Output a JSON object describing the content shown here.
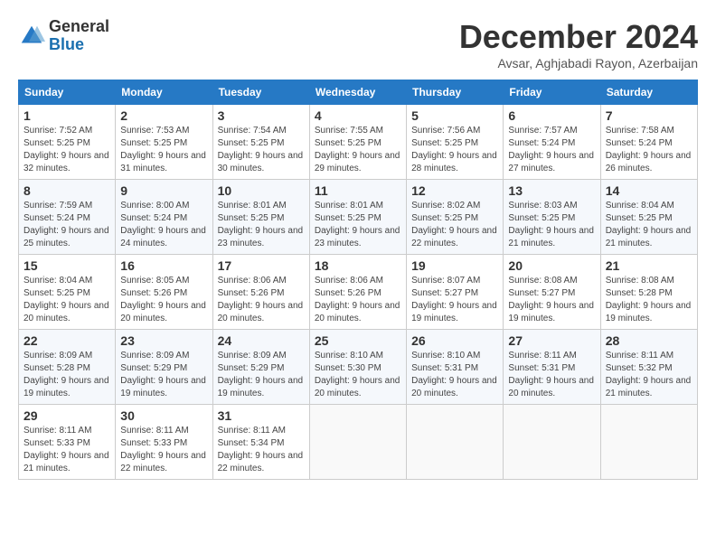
{
  "header": {
    "logo": {
      "general": "General",
      "blue": "Blue"
    },
    "title": "December 2024",
    "location": "Avsar, Aghjabadi Rayon, Azerbaijan"
  },
  "calendar": {
    "days_of_week": [
      "Sunday",
      "Monday",
      "Tuesday",
      "Wednesday",
      "Thursday",
      "Friday",
      "Saturday"
    ],
    "weeks": [
      [
        {
          "day": "1",
          "sunrise": "7:52 AM",
          "sunset": "5:25 PM",
          "daylight": "9 hours and 32 minutes."
        },
        {
          "day": "2",
          "sunrise": "7:53 AM",
          "sunset": "5:25 PM",
          "daylight": "9 hours and 31 minutes."
        },
        {
          "day": "3",
          "sunrise": "7:54 AM",
          "sunset": "5:25 PM",
          "daylight": "9 hours and 30 minutes."
        },
        {
          "day": "4",
          "sunrise": "7:55 AM",
          "sunset": "5:25 PM",
          "daylight": "9 hours and 29 minutes."
        },
        {
          "day": "5",
          "sunrise": "7:56 AM",
          "sunset": "5:25 PM",
          "daylight": "9 hours and 28 minutes."
        },
        {
          "day": "6",
          "sunrise": "7:57 AM",
          "sunset": "5:24 PM",
          "daylight": "9 hours and 27 minutes."
        },
        {
          "day": "7",
          "sunrise": "7:58 AM",
          "sunset": "5:24 PM",
          "daylight": "9 hours and 26 minutes."
        }
      ],
      [
        {
          "day": "8",
          "sunrise": "7:59 AM",
          "sunset": "5:24 PM",
          "daylight": "9 hours and 25 minutes."
        },
        {
          "day": "9",
          "sunrise": "8:00 AM",
          "sunset": "5:24 PM",
          "daylight": "9 hours and 24 minutes."
        },
        {
          "day": "10",
          "sunrise": "8:01 AM",
          "sunset": "5:25 PM",
          "daylight": "9 hours and 23 minutes."
        },
        {
          "day": "11",
          "sunrise": "8:01 AM",
          "sunset": "5:25 PM",
          "daylight": "9 hours and 23 minutes."
        },
        {
          "day": "12",
          "sunrise": "8:02 AM",
          "sunset": "5:25 PM",
          "daylight": "9 hours and 22 minutes."
        },
        {
          "day": "13",
          "sunrise": "8:03 AM",
          "sunset": "5:25 PM",
          "daylight": "9 hours and 21 minutes."
        },
        {
          "day": "14",
          "sunrise": "8:04 AM",
          "sunset": "5:25 PM",
          "daylight": "9 hours and 21 minutes."
        }
      ],
      [
        {
          "day": "15",
          "sunrise": "8:04 AM",
          "sunset": "5:25 PM",
          "daylight": "9 hours and 20 minutes."
        },
        {
          "day": "16",
          "sunrise": "8:05 AM",
          "sunset": "5:26 PM",
          "daylight": "9 hours and 20 minutes."
        },
        {
          "day": "17",
          "sunrise": "8:06 AM",
          "sunset": "5:26 PM",
          "daylight": "9 hours and 20 minutes."
        },
        {
          "day": "18",
          "sunrise": "8:06 AM",
          "sunset": "5:26 PM",
          "daylight": "9 hours and 20 minutes."
        },
        {
          "day": "19",
          "sunrise": "8:07 AM",
          "sunset": "5:27 PM",
          "daylight": "9 hours and 19 minutes."
        },
        {
          "day": "20",
          "sunrise": "8:08 AM",
          "sunset": "5:27 PM",
          "daylight": "9 hours and 19 minutes."
        },
        {
          "day": "21",
          "sunrise": "8:08 AM",
          "sunset": "5:28 PM",
          "daylight": "9 hours and 19 minutes."
        }
      ],
      [
        {
          "day": "22",
          "sunrise": "8:09 AM",
          "sunset": "5:28 PM",
          "daylight": "9 hours and 19 minutes."
        },
        {
          "day": "23",
          "sunrise": "8:09 AM",
          "sunset": "5:29 PM",
          "daylight": "9 hours and 19 minutes."
        },
        {
          "day": "24",
          "sunrise": "8:09 AM",
          "sunset": "5:29 PM",
          "daylight": "9 hours and 19 minutes."
        },
        {
          "day": "25",
          "sunrise": "8:10 AM",
          "sunset": "5:30 PM",
          "daylight": "9 hours and 20 minutes."
        },
        {
          "day": "26",
          "sunrise": "8:10 AM",
          "sunset": "5:31 PM",
          "daylight": "9 hours and 20 minutes."
        },
        {
          "day": "27",
          "sunrise": "8:11 AM",
          "sunset": "5:31 PM",
          "daylight": "9 hours and 20 minutes."
        },
        {
          "day": "28",
          "sunrise": "8:11 AM",
          "sunset": "5:32 PM",
          "daylight": "9 hours and 21 minutes."
        }
      ],
      [
        {
          "day": "29",
          "sunrise": "8:11 AM",
          "sunset": "5:33 PM",
          "daylight": "9 hours and 21 minutes."
        },
        {
          "day": "30",
          "sunrise": "8:11 AM",
          "sunset": "5:33 PM",
          "daylight": "9 hours and 22 minutes."
        },
        {
          "day": "31",
          "sunrise": "8:11 AM",
          "sunset": "5:34 PM",
          "daylight": "9 hours and 22 minutes."
        },
        null,
        null,
        null,
        null
      ]
    ]
  }
}
